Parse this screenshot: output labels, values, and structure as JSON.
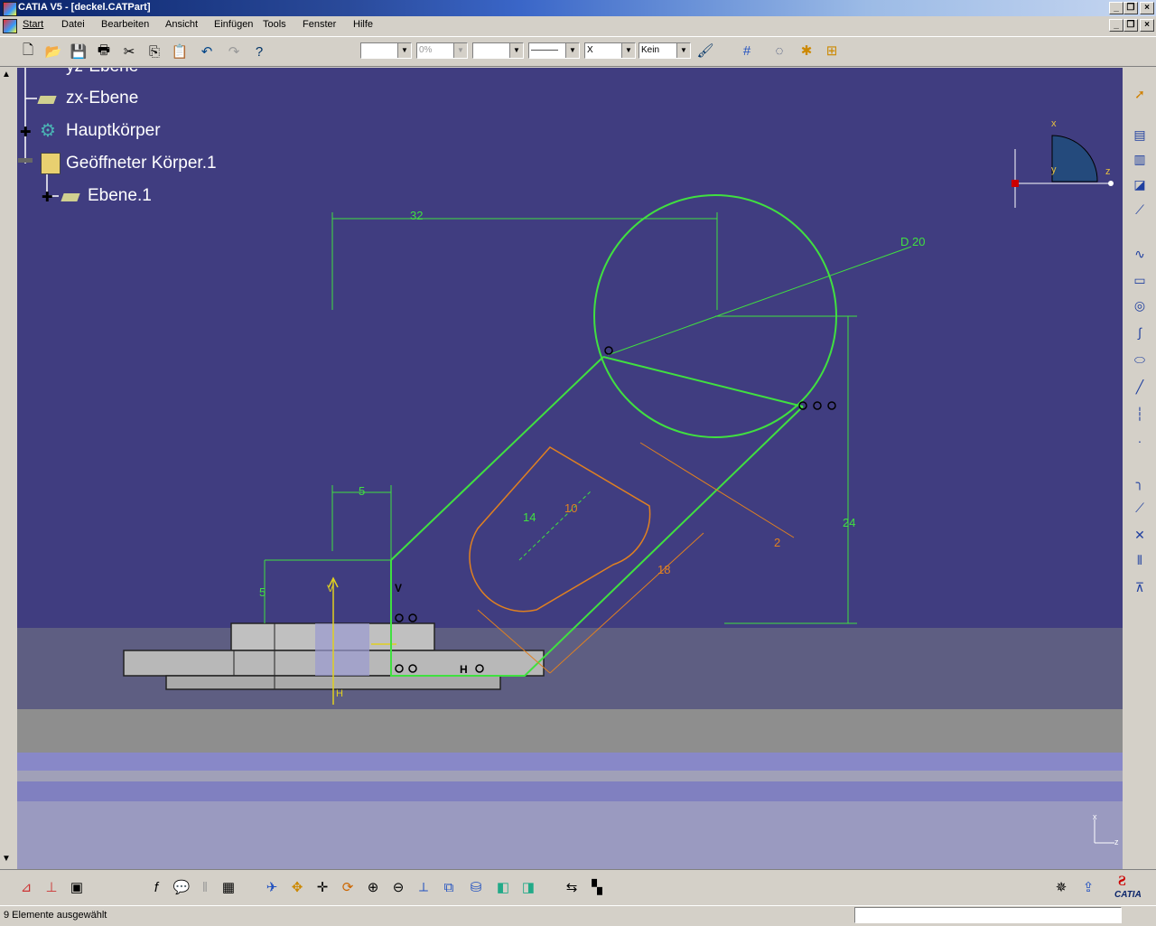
{
  "window": {
    "title": "CATIA V5 - [deckel.CATPart]"
  },
  "menu": [
    "Start",
    "Datei",
    "Bearbeiten",
    "Ansicht",
    "Einfügen",
    "Tools",
    "Fenster",
    "Hilfe"
  ],
  "toolbar": {
    "combo_style": "",
    "combo_transparency": "0%",
    "combo_thickness": "",
    "combo_linetype": "———",
    "combo_point": "X",
    "combo_layer": "Kein"
  },
  "tree": [
    {
      "label": "yz-Ebene",
      "icon": "plane-icon"
    },
    {
      "label": "zx-Ebene",
      "icon": "plane-icon"
    },
    {
      "label": "Hauptkörper",
      "icon": "gear-body-icon"
    },
    {
      "label": "Geöffneter Körper.1",
      "icon": "open-body-icon"
    },
    {
      "label": "Ebene.1",
      "icon": "plane-icon"
    }
  ],
  "sketch": {
    "dimensions": [
      "32",
      "D 20",
      "5",
      "14",
      "10",
      "2",
      "24",
      "18",
      "5"
    ],
    "constraint_v": "V",
    "constraint_h": "H",
    "axis_v": "V",
    "axis_h": "H"
  },
  "compass": {
    "x": "x",
    "y": "y",
    "z": "z"
  },
  "axes_mini": {
    "x": "x",
    "z": "z"
  },
  "status": {
    "text": "9 Elemente ausgewählt"
  },
  "brand": {
    "logo_text": "CATIA"
  },
  "colors": {
    "viewport": "#403d80",
    "sketch_green": "#40e040",
    "profile_orange": "#e08020",
    "axis_yellow": "#e0d020"
  }
}
